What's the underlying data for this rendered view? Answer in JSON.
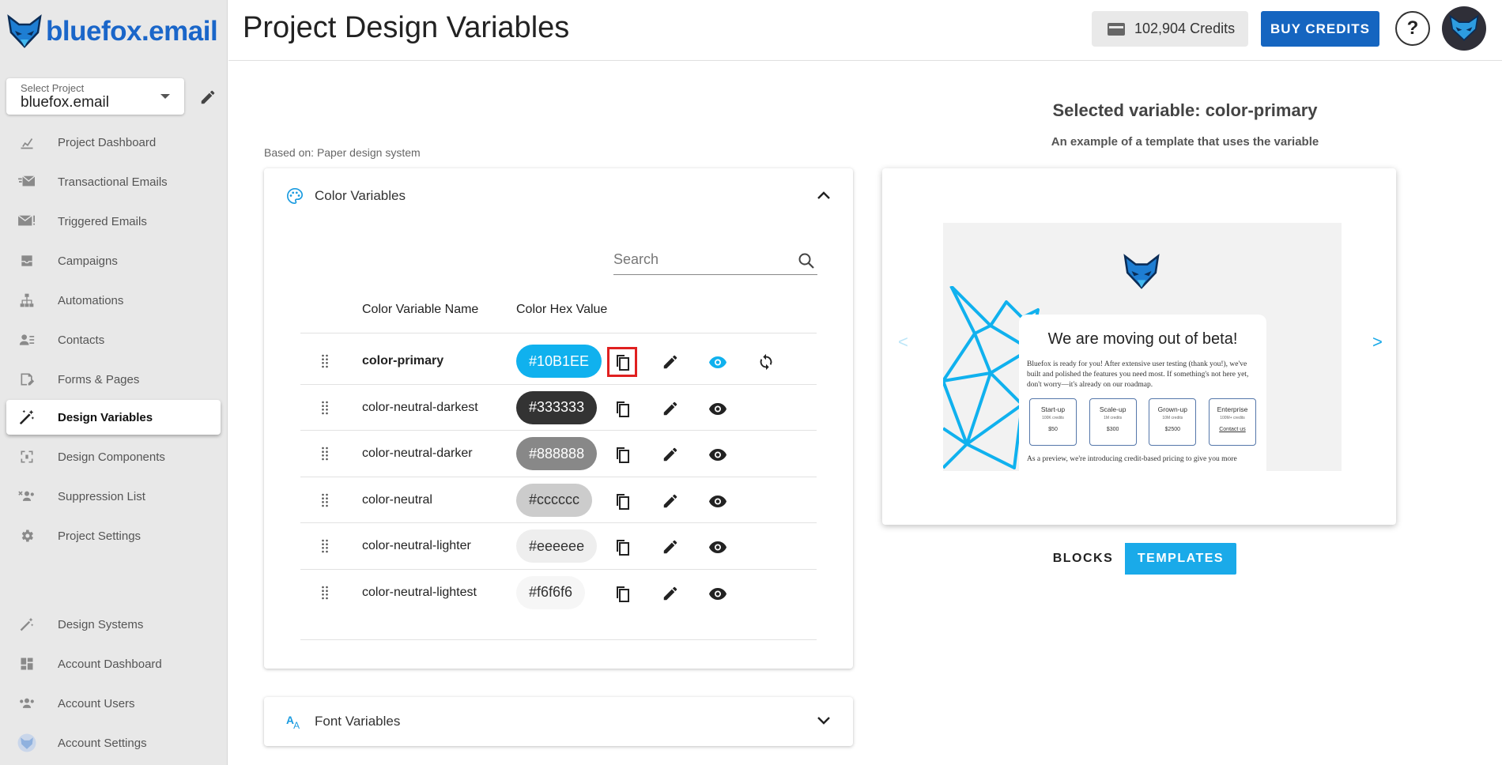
{
  "app": {
    "logo_text": "bluefox.email"
  },
  "colors": {
    "accent": "#1565c0",
    "primary_chip": "#10B1EE",
    "sidebar_bg": "#e8e8e8"
  },
  "project_select": {
    "label": "Select Project",
    "value": "bluefox.email"
  },
  "sidebar": {
    "items": [
      {
        "label": "Project Dashboard",
        "icon": "chart-icon"
      },
      {
        "label": "Transactional Emails",
        "icon": "fast-mail-icon"
      },
      {
        "label": "Triggered Emails",
        "icon": "mail-alert-icon"
      },
      {
        "label": "Campaigns",
        "icon": "inbox-icon"
      },
      {
        "label": "Automations",
        "icon": "sitemap-icon"
      },
      {
        "label": "Contacts",
        "icon": "contacts-icon"
      },
      {
        "label": "Forms & Pages",
        "icon": "form-edit-icon"
      },
      {
        "label": "Design Variables",
        "icon": "magic-wand-icon"
      },
      {
        "label": "Design Components",
        "icon": "components-icon"
      },
      {
        "label": "Suppression List",
        "icon": "block-users-icon"
      },
      {
        "label": "Project Settings",
        "icon": "gear-icon"
      },
      {
        "label": "Design Systems",
        "icon": "magic-wand-icon"
      },
      {
        "label": "Account Dashboard",
        "icon": "dashboard-icon"
      },
      {
        "label": "Account Users",
        "icon": "users-icon"
      },
      {
        "label": "Account Settings",
        "icon": "fox-icon"
      }
    ]
  },
  "header": {
    "title": "Project Design Variables",
    "credits": "102,904 Credits",
    "buy_label": "BUY CREDITS",
    "help_label": "?"
  },
  "main": {
    "based_on": "Based on: Paper design system",
    "color_panel": {
      "title": "Color Variables",
      "search_placeholder": "Search",
      "columns": [
        "Color Variable Name",
        "Color Hex Value"
      ],
      "rows": [
        {
          "name": "color-primary",
          "hex": "#10B1EE",
          "bg": "#10B1EE",
          "fg": "#ffffff",
          "bold": true,
          "active": true
        },
        {
          "name": "color-neutral-darkest",
          "hex": "#333333",
          "bg": "#333333",
          "fg": "#ffffff"
        },
        {
          "name": "color-neutral-darker",
          "hex": "#888888",
          "bg": "#888888",
          "fg": "#ffffff"
        },
        {
          "name": "color-neutral",
          "hex": "#cccccc",
          "bg": "#cccccc",
          "fg": "#333333"
        },
        {
          "name": "color-neutral-lighter",
          "hex": "#eeeeee",
          "bg": "#eeeeee",
          "fg": "#333333"
        },
        {
          "name": "color-neutral-lightest",
          "hex": "#f6f6f6",
          "bg": "#f6f6f6",
          "fg": "#333333"
        }
      ]
    },
    "font_panel": {
      "title": "Font Variables"
    }
  },
  "preview": {
    "title": "Selected variable: color-primary",
    "subtitle": "An example of a template that uses the variable",
    "prev": "<",
    "next": ">",
    "email": {
      "heading": "We are moving out of beta!",
      "body": "Bluefox is ready for you! After extensive user testing (thank you!), we've built and polished the features you need most. If something's not here yet, don't worry—it's already on our roadmap.",
      "plans": [
        {
          "name": "Start-up",
          "credits": "100K credits",
          "price": "$50"
        },
        {
          "name": "Scale-up",
          "credits": "1M credits",
          "price": "$300"
        },
        {
          "name": "Grown-up",
          "credits": "10M credits",
          "price": "$2500"
        },
        {
          "name": "Enterprise",
          "credits": "100M+ credits",
          "price": "Contact us"
        }
      ],
      "footer": "As a preview, we're introducing credit-based pricing to give you more"
    },
    "toggle": {
      "blocks": "BLOCKS",
      "templates": "TEMPLATES"
    }
  }
}
